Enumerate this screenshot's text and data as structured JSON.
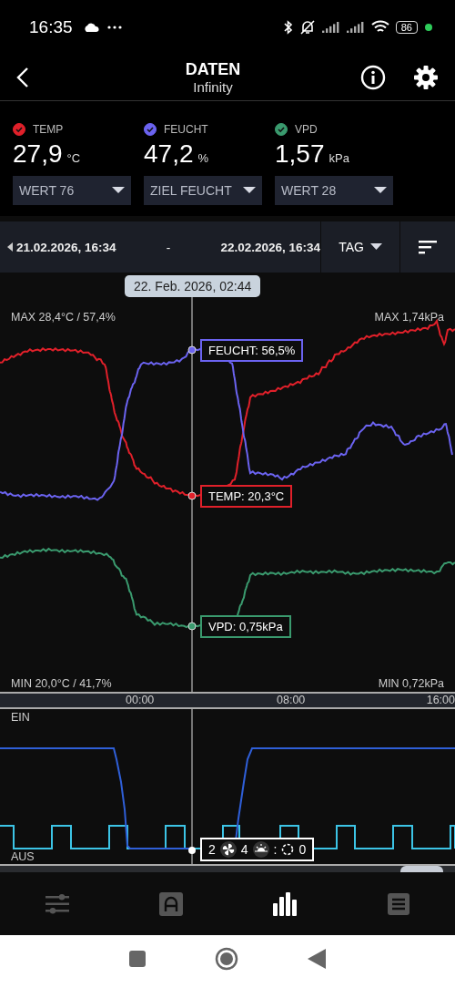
{
  "status_bar": {
    "time": "16:35",
    "battery": "86"
  },
  "header": {
    "title": "DATEN",
    "subtitle": "Infinity"
  },
  "metrics": [
    {
      "label": "TEMP",
      "value": "27,9",
      "unit": "°C",
      "color": "#e0202a",
      "checked": true,
      "dropdown": "WERT 76"
    },
    {
      "label": "FEUCHT",
      "value": "47,2",
      "unit": "%",
      "color": "#6b63f0",
      "checked": true,
      "dropdown": "ZIEL FEUCHT"
    },
    {
      "label": "VPD",
      "value": "1,57",
      "unit": "kPa",
      "color": "#3a9a6e",
      "checked": true,
      "dropdown": "WERT 28"
    }
  ],
  "range": {
    "start": "21.02.2026, 16:34",
    "separator": "-",
    "end": "22.02.2026, 16:34",
    "period": "TAG"
  },
  "chart": {
    "tooltip": "22. Feb. 2026, 02:44",
    "max_left": "MAX 28,4°C / 57,4%",
    "max_right": "MAX 1,74kPa",
    "min_left": "MIN 20,0°C / 41,7%",
    "min_right": "MIN 0,72kPa",
    "callouts": [
      {
        "text": "FEUCHT: 56,5%",
        "color": "#6b63f0"
      },
      {
        "text": "TEMP: 20,3°C",
        "color": "#e0202a"
      },
      {
        "text": "VPD: 0,75kPa",
        "color": "#3a9a6e"
      }
    ],
    "x_labels": [
      "00:00",
      "08:00",
      "16:00"
    ]
  },
  "switch_chart": {
    "top": "EIN",
    "bottom": "AUS",
    "readout": [
      {
        "kind": "text",
        "text": "2"
      },
      {
        "kind": "fan"
      },
      {
        "kind": "text",
        "text": "4"
      },
      {
        "kind": "sun"
      },
      {
        "kind": "text",
        "text": ":"
      },
      {
        "kind": "ring"
      },
      {
        "kind": "text",
        "text": "0"
      }
    ]
  },
  "bottom_nav": [
    {
      "kind": "sliders",
      "selected": false
    },
    {
      "kind": "auto",
      "selected": false
    },
    {
      "kind": "chart",
      "selected": true
    },
    {
      "kind": "list",
      "selected": false
    }
  ]
}
